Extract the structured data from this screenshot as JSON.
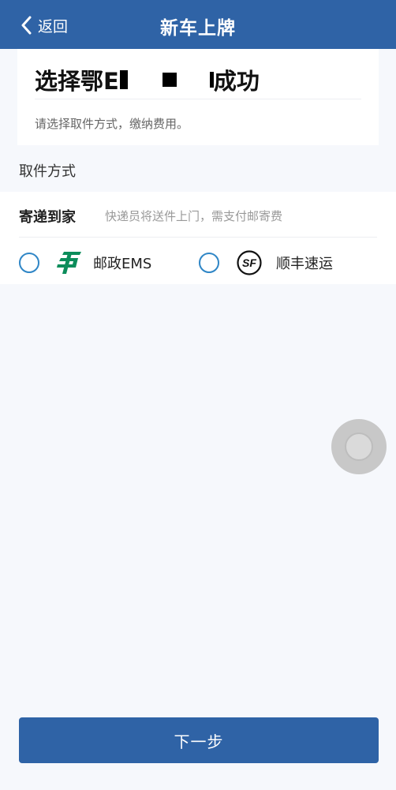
{
  "nav": {
    "back_label": "返回",
    "title": "新车上牌"
  },
  "card": {
    "headline_prefix": "选择鄂E",
    "headline_suffix": "成功",
    "hint": "请选择取件方式，缴纳费用。"
  },
  "section": {
    "pickup_method_label": "取件方式"
  },
  "delivery": {
    "title": "寄递到家",
    "description": "快递员将送件上门，需支付邮寄费",
    "options": [
      {
        "label": "邮政EMS",
        "icon": "china-post-icon",
        "selected": false
      },
      {
        "label": "顺丰速运",
        "icon": "sf-express-icon",
        "selected": false
      }
    ]
  },
  "footer": {
    "next_label": "下一步"
  },
  "colors": {
    "primary": "#2f63a6",
    "radio_border": "#2f86c6",
    "ems_green": "#0c8d5b"
  }
}
